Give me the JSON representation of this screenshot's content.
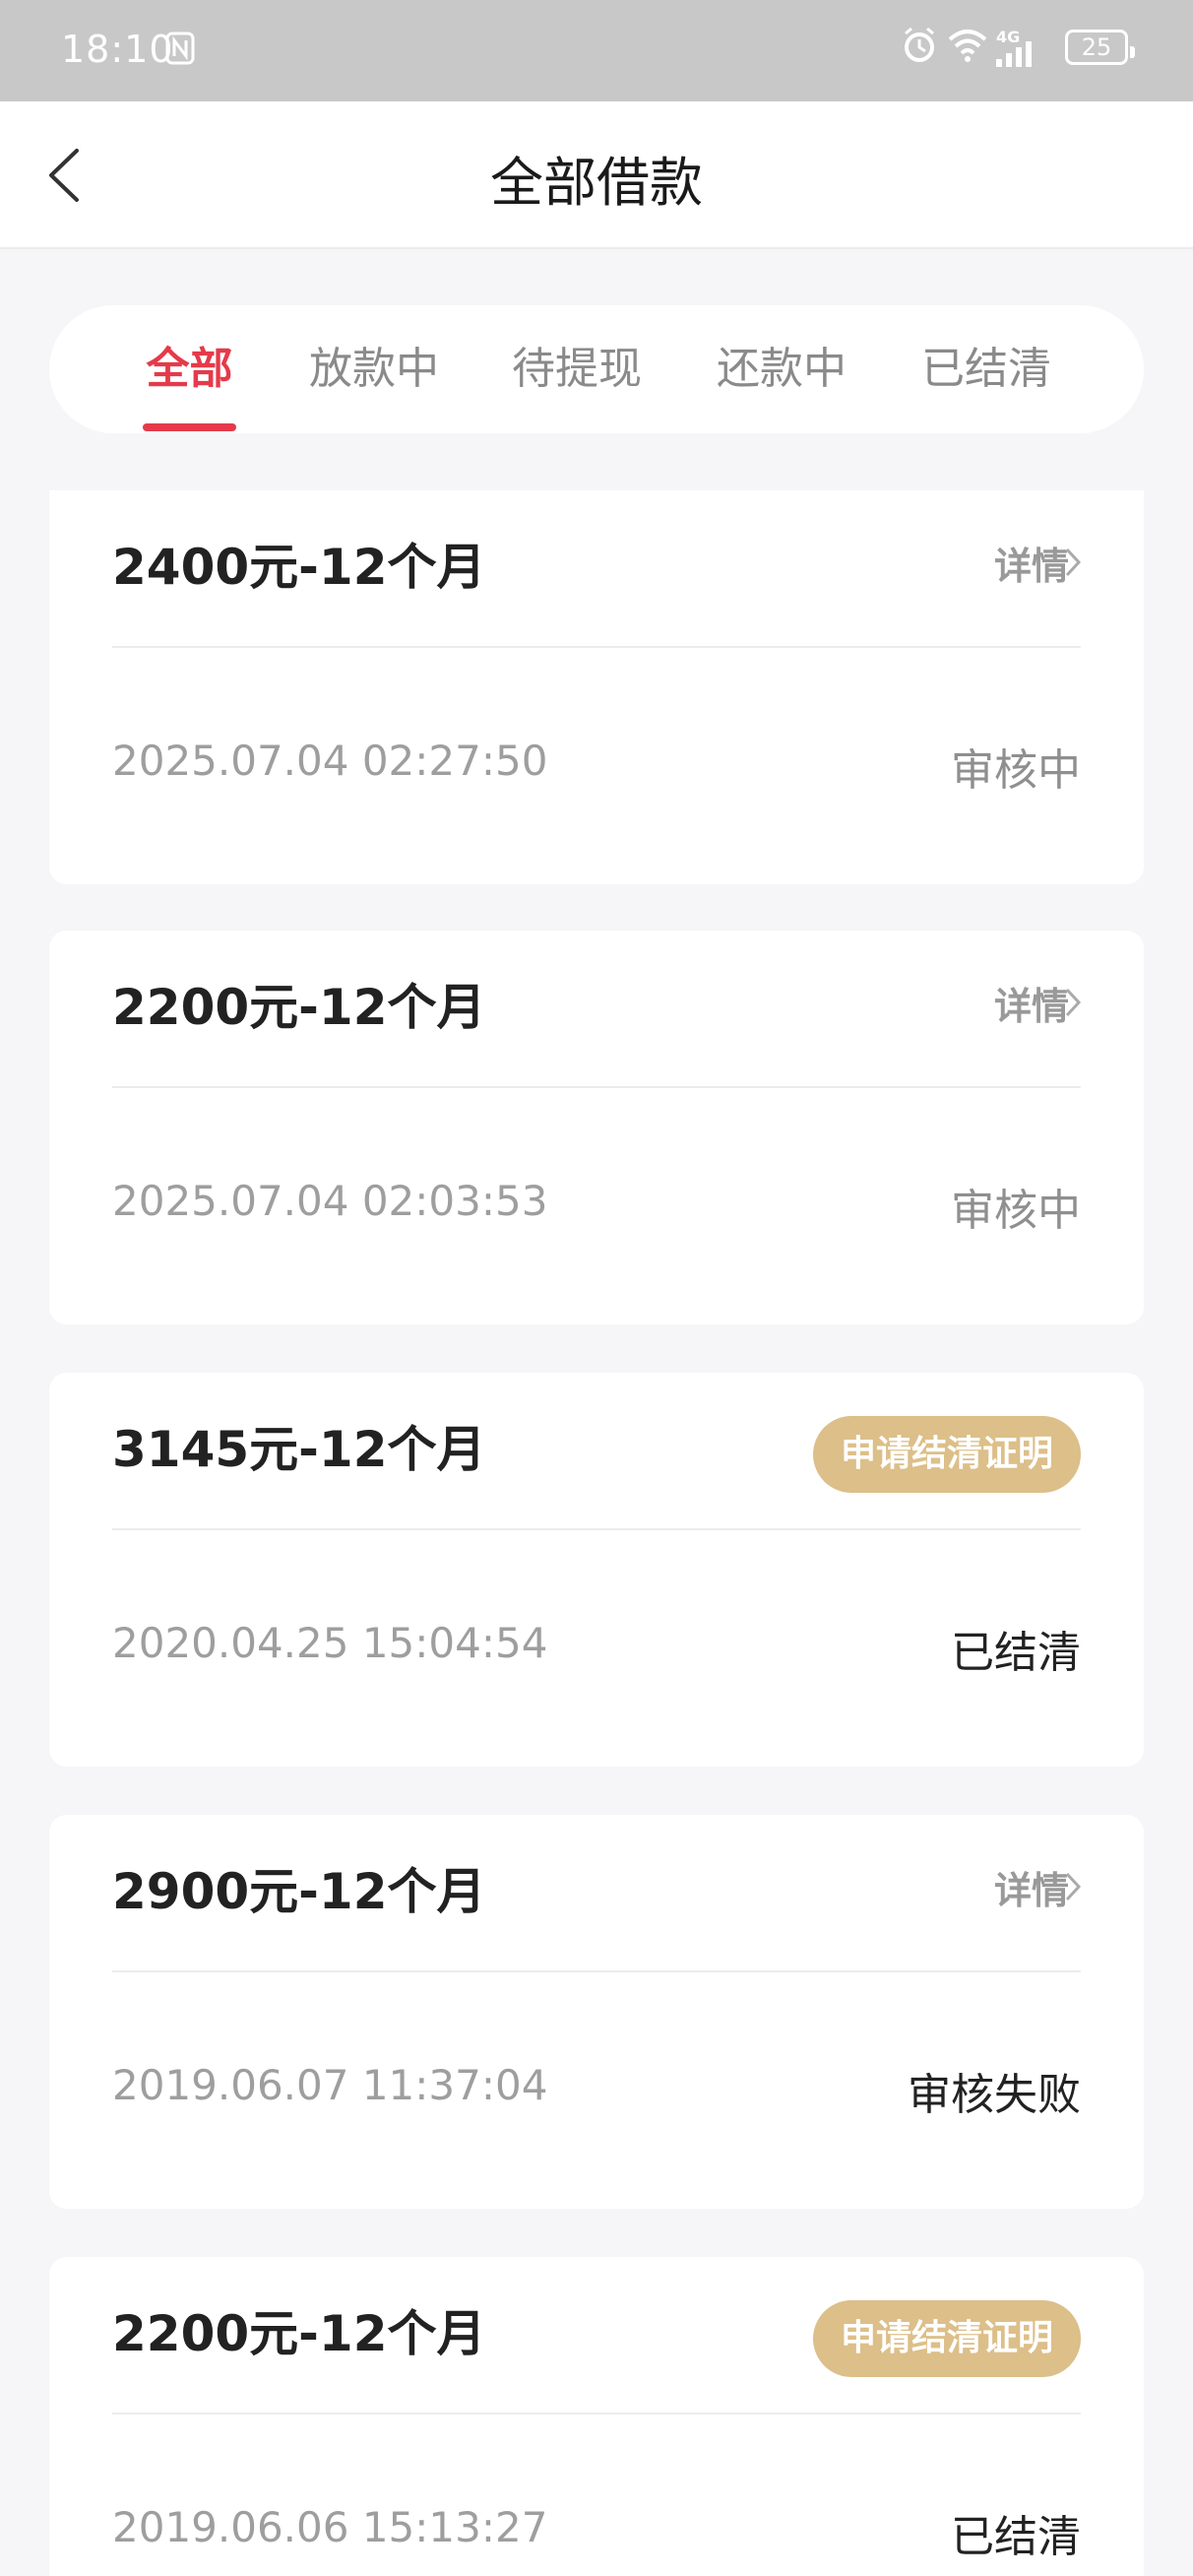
{
  "status_bar": {
    "time": "18:10",
    "network": "4G",
    "battery": "25"
  },
  "nav": {
    "title": "全部借款"
  },
  "tabs": [
    {
      "label": "全部",
      "active": true
    },
    {
      "label": "放款中",
      "active": false
    },
    {
      "label": "待提现",
      "active": false
    },
    {
      "label": "还款中",
      "active": false
    },
    {
      "label": "已结清",
      "active": false
    }
  ],
  "loans": [
    {
      "title": "2400元-12个月",
      "action": "详情",
      "date": "2025.07.04 02:27:50",
      "status": "审核中"
    },
    {
      "title": "2200元-12个月",
      "action": "详情",
      "date": "2025.07.04 02:03:53",
      "status": "审核中"
    },
    {
      "title": "3145元-12个月",
      "action": "申请结清证明",
      "date": "2020.04.25 15:04:54",
      "status": "已结清"
    },
    {
      "title": "2900元-12个月",
      "action": "详情",
      "date": "2019.06.07 11:37:04",
      "status": "审核失败"
    },
    {
      "title": "2200元-12个月",
      "action": "申请结清证明",
      "date": "2019.06.06 15:13:27",
      "status": "已结清"
    }
  ],
  "colors": {
    "accent": "#e53a4a",
    "cert_button": "#dcbf89"
  }
}
